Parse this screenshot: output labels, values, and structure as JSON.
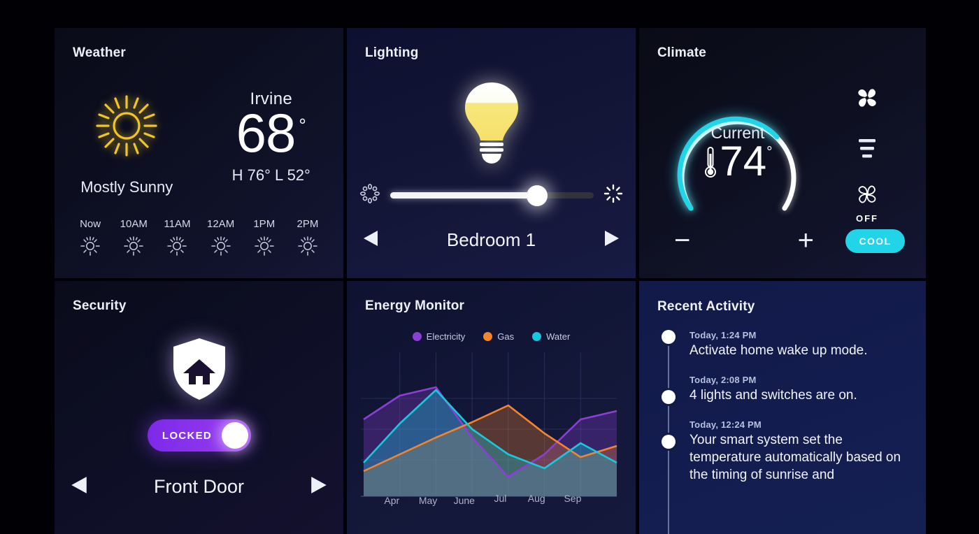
{
  "theme": {
    "page_bg": "#000005",
    "accent_cyan": "#21d4e8",
    "accent_purple": "#8b3fd4",
    "accent_orange": "#f5842a",
    "sun_gold": "#f0c52a",
    "bulb_yellow": "#f7e67a",
    "lock_purple": "#7c2ae8"
  },
  "weather": {
    "title": "Weather",
    "icon": "sun-icon",
    "condition": "Mostly Sunny",
    "city": "Irvine",
    "temperature": "68",
    "degree": "°",
    "high_low": "H 76°  L 52°",
    "hours": [
      {
        "label": "Now",
        "icon": "sun-small-icon"
      },
      {
        "label": "10AM",
        "icon": "sun-small-icon"
      },
      {
        "label": "11AM",
        "icon": "sun-small-icon"
      },
      {
        "label": "12AM",
        "icon": "sun-small-icon"
      },
      {
        "label": "1PM",
        "icon": "sun-small-icon"
      },
      {
        "label": "2PM",
        "icon": "sun-small-icon"
      }
    ]
  },
  "lighting": {
    "title": "Lighting",
    "bulb_icon": "lightbulb-icon",
    "brightness_percent": 72,
    "low_icon": "dim-icon",
    "high_icon": "bright-icon",
    "room": "Bedroom 1",
    "prev_icon": "arrow-left-icon",
    "next_icon": "arrow-right-icon"
  },
  "climate": {
    "title": "Climate",
    "gauge_label": "Current",
    "temperature": "74",
    "degree": "°",
    "thermometer_icon": "thermometer-icon",
    "gauge_percent": 78,
    "minus_label": "−",
    "plus_label": "+",
    "fan_icon": "fan-filled-icon",
    "speed_icon": "fan-speed-bars-icon",
    "fan_off_icon": "fan-outline-icon",
    "fan_off_label": "OFF",
    "mode_label": "COOL"
  },
  "security": {
    "title": "Security",
    "shield_icon": "shield-home-icon",
    "lock_state": "LOCKED",
    "device": "Front Door",
    "prev_icon": "arrow-left-icon",
    "next_icon": "arrow-right-icon"
  },
  "energy": {
    "title": "Energy Monitor"
  },
  "chart_data": {
    "type": "area",
    "title": "Energy Monitor",
    "xlabel": "",
    "ylabel": "",
    "categories": [
      "Apr",
      "May",
      "June",
      "Jul",
      "Aug",
      "Sep"
    ],
    "x_tick_labels": [
      "Apr",
      "May",
      "June",
      "Jul",
      "Aug",
      "Sep"
    ],
    "grid": true,
    "legend_position": "top-center",
    "ylim": [
      0,
      100
    ],
    "series": [
      {
        "name": "Electricity",
        "color": "#8b3fd4",
        "values": [
          55,
          72,
          78,
          42,
          14,
          30,
          55,
          61
        ]
      },
      {
        "name": "Gas",
        "color": "#f5842a",
        "values": [
          18,
          30,
          42,
          53,
          65,
          45,
          28,
          36
        ]
      },
      {
        "name": "Water",
        "color": "#18c8dc",
        "values": [
          24,
          52,
          76,
          48,
          30,
          20,
          38,
          24
        ]
      }
    ],
    "x_points": [
      0,
      1,
      2,
      3,
      4,
      5,
      6,
      7
    ]
  },
  "activity": {
    "title": "Recent Activity",
    "items": [
      {
        "time": "Today, 1:24 PM",
        "text": "Activate home wake up mode."
      },
      {
        "time": "Today, 2:08 PM",
        "text": "4 lights and switches are on."
      },
      {
        "time": "Today, 12:24 PM",
        "text": "Your smart system set the temperature automatically based on the timing of sunrise and"
      }
    ]
  }
}
